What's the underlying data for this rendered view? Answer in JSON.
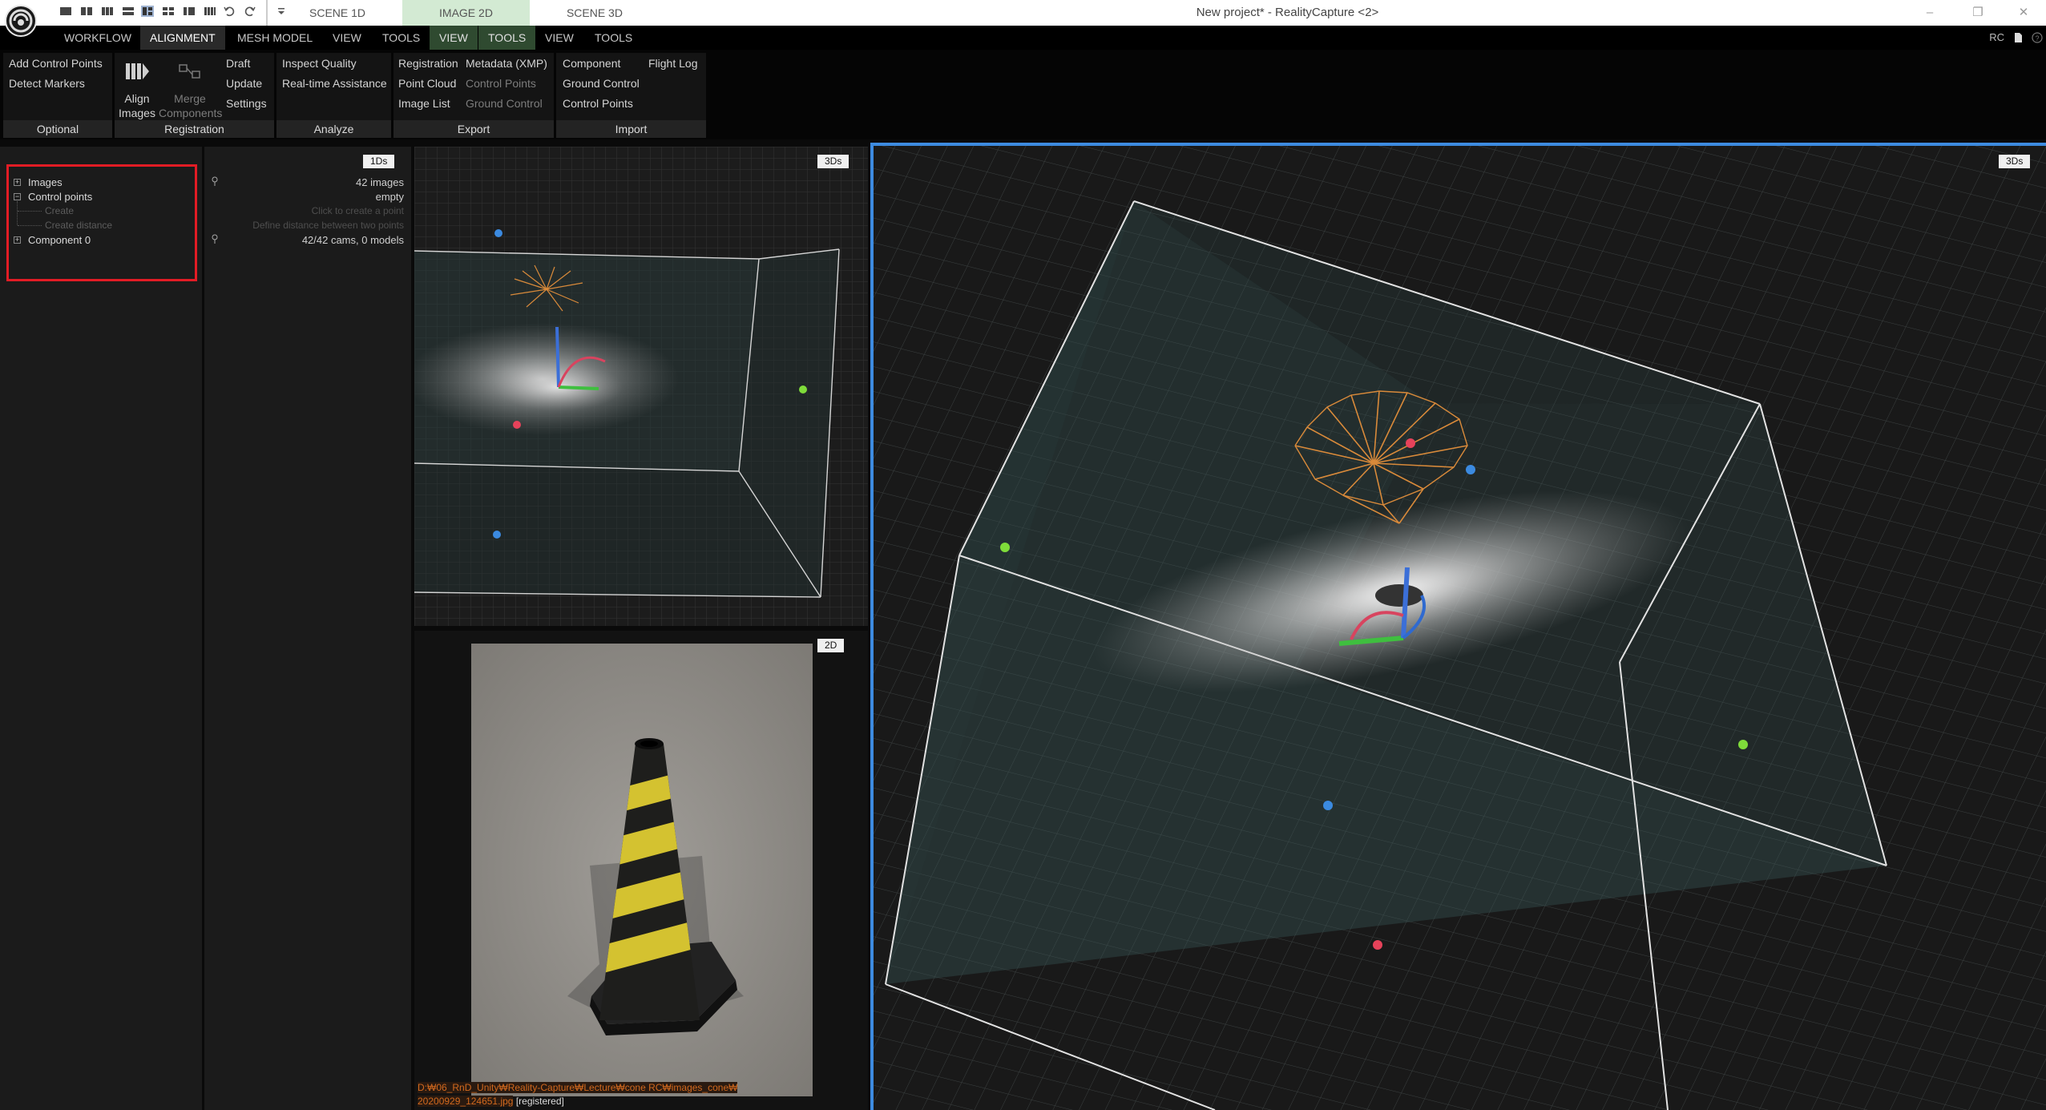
{
  "titlebar": {
    "scene_tabs": [
      "SCENE 1D",
      "IMAGE 2D",
      "SCENE 3D"
    ],
    "active_tab": "IMAGE 2D",
    "window_title": "New project* - RealityCapture <2>",
    "window_buttons": {
      "minimize": "–",
      "restore": "❐",
      "close": "✕"
    }
  },
  "menu": {
    "items": [
      "WORKFLOW",
      "ALIGNMENT",
      "MESH MODEL",
      "VIEW",
      "TOOLS",
      "VIEW",
      "TOOLS",
      "VIEW",
      "TOOLS"
    ],
    "active": "ALIGNMENT",
    "context_tabs": [
      "VIEW",
      "TOOLS"
    ],
    "right_label": "RC"
  },
  "ribbon": {
    "optional": {
      "links": [
        "Add Control Points",
        "Detect Markers"
      ],
      "footer": "Optional"
    },
    "registration": {
      "align_label": "Align Images",
      "merge_label": "Merge Components",
      "links": [
        "Draft",
        "Update",
        "Settings"
      ],
      "footer": "Registration"
    },
    "analyze": {
      "links": [
        "Inspect Quality",
        "Real-time Assistance"
      ],
      "footer": "Analyze"
    },
    "export": {
      "links": [
        "Registration",
        "Point Cloud",
        "Image List",
        "Metadata (XMP)",
        "Control Points",
        "Ground Control"
      ],
      "footer": "Export"
    },
    "import": {
      "links": [
        "Component",
        "Ground Control",
        "Control Points",
        "Flight Log"
      ],
      "footer": "Import"
    }
  },
  "tree": {
    "items": [
      {
        "label": "Images",
        "value": "42 images"
      },
      {
        "label": "Control points",
        "value": "empty"
      },
      {
        "label": "Create",
        "value": "Click to create a point"
      },
      {
        "label": "Create distance",
        "value": "Define distance between two points"
      },
      {
        "label": "Component 0",
        "value": "42/42 cams, 0 models"
      }
    ]
  },
  "viewports": {
    "info_tag": "1Ds",
    "small_3d_tag": "3Ds",
    "image_tag": "2D",
    "big_3d_tag": "3Ds"
  },
  "image_view": {
    "path": "D:₩06_RnD_Unity₩Reality-Capture₩Lecture₩cone RC₩images_cone₩",
    "filename": "20200929_124651.jpg",
    "status": "[registered]"
  },
  "colors": {
    "accent_blue": "#3d8be0",
    "highlight_red": "#e21c25",
    "active_tab_green": "#d3ead3",
    "camera_orange": "#d98a3a"
  }
}
